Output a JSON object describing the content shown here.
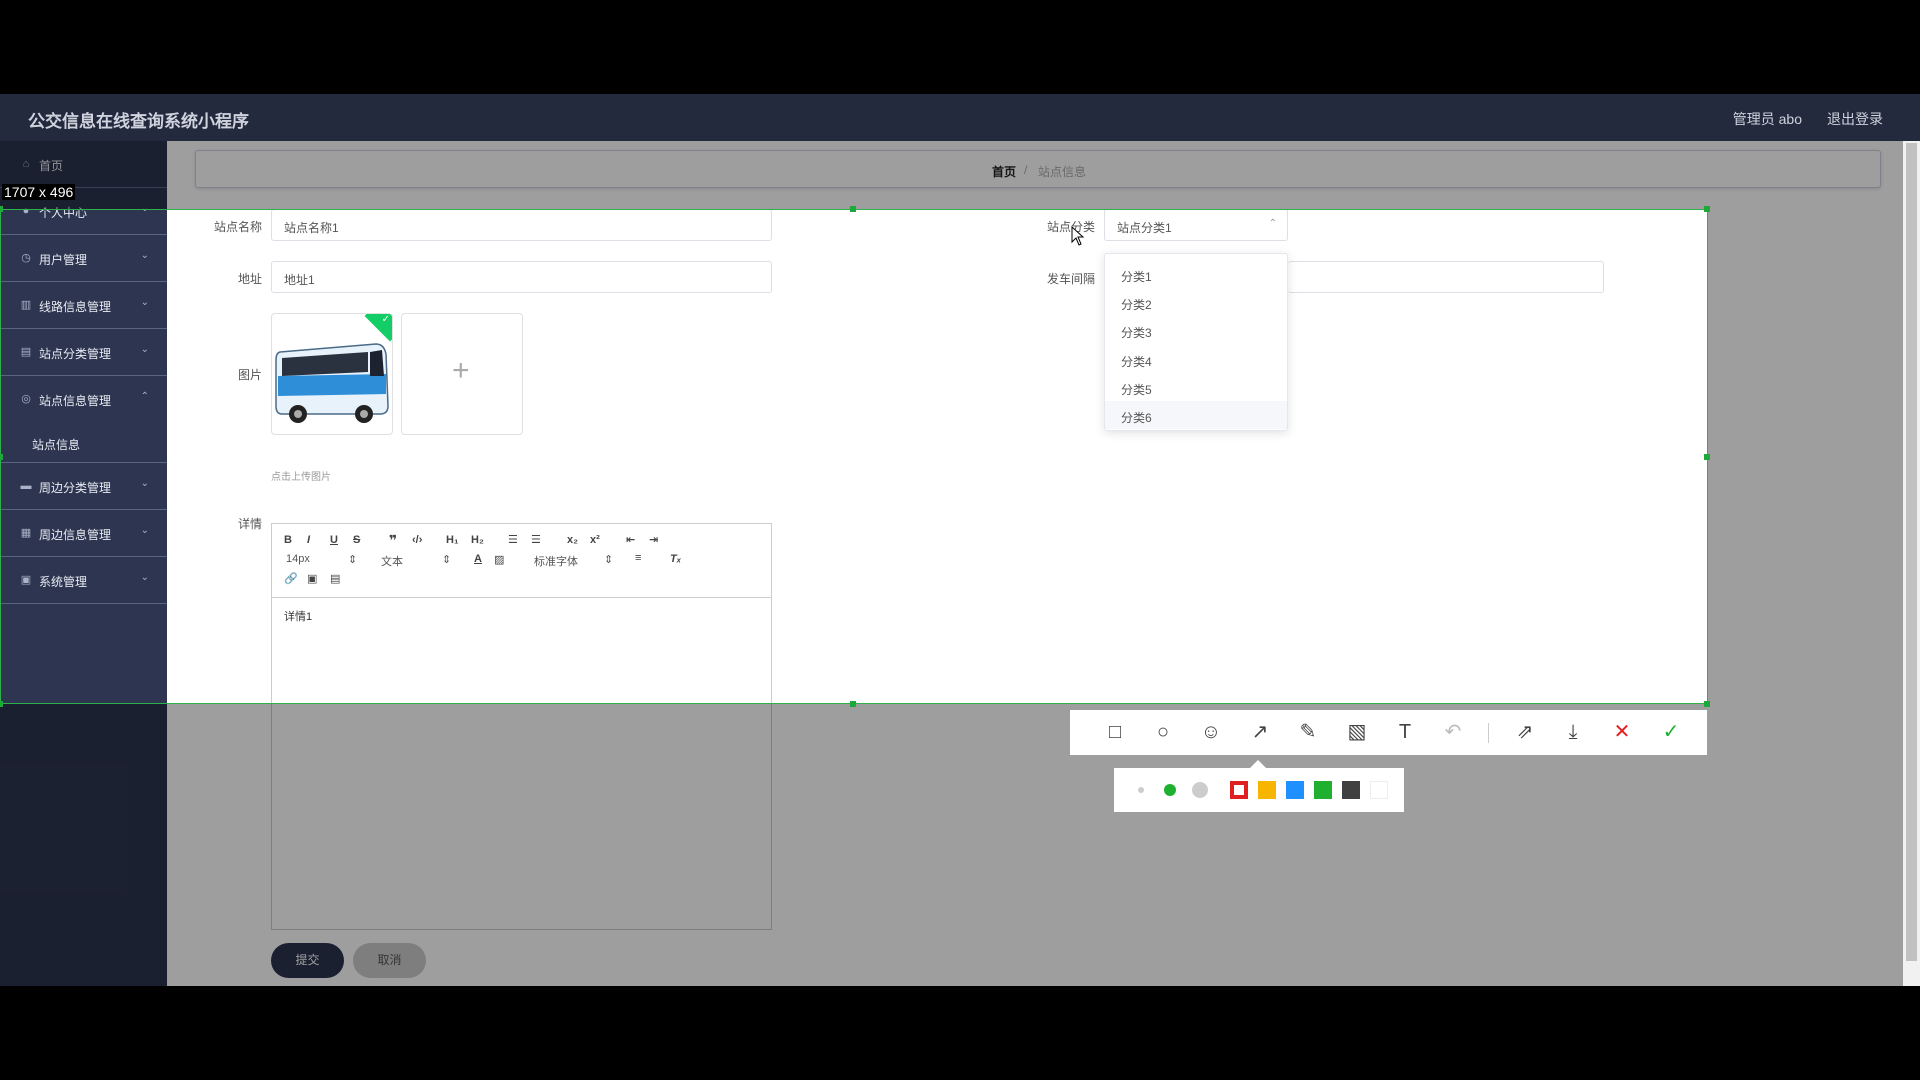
{
  "app": {
    "title": "公交信息在线查询系统小程序",
    "user": "管理员 abo",
    "logout": "退出登录"
  },
  "sidebar": {
    "items": [
      {
        "label": "首页",
        "icon": "home-icon"
      },
      {
        "label": "个人中心",
        "icon": "user-icon"
      },
      {
        "label": "用户管理",
        "icon": "clock-icon"
      },
      {
        "label": "线路信息管理",
        "icon": "chart-icon"
      },
      {
        "label": "站点分类管理",
        "icon": "clipboard-icon"
      },
      {
        "label": "站点信息管理",
        "icon": "compass-icon"
      },
      {
        "label": "周边分类管理",
        "icon": "briefcase-icon"
      },
      {
        "label": "周边信息管理",
        "icon": "grid-icon"
      },
      {
        "label": "系统管理",
        "icon": "picture-icon"
      }
    ],
    "sub_item": "站点信息"
  },
  "breadcrumb": {
    "home": "首页",
    "sep": "/",
    "current": "站点信息"
  },
  "form": {
    "name_label": "站点名称",
    "name_value": "站点名称1",
    "category_label": "站点分类",
    "category_value": "站点分类1",
    "address_label": "地址",
    "address_value": "地址1",
    "interval_label": "发车间隔",
    "image_label": "图片",
    "upload_hint": "点击上传图片",
    "detail_label": "详情",
    "detail_content": "详情1",
    "submit": "提交",
    "cancel": "取消"
  },
  "editor_toolbar": {
    "font_size": "14px",
    "text_style": "文本",
    "font_family": "标准字体"
  },
  "dropdown": {
    "options": [
      "分类1",
      "分类2",
      "分类3",
      "分类4",
      "分类5",
      "分类6"
    ]
  },
  "capture": {
    "size_label": "1707 x 496"
  },
  "colors": {
    "accent": "#2d3550",
    "selection": "#2bb04a",
    "palette": [
      "#e02020",
      "#f7b500",
      "#1e90ff",
      "#20b030",
      "#404040",
      "#ffffff"
    ]
  }
}
